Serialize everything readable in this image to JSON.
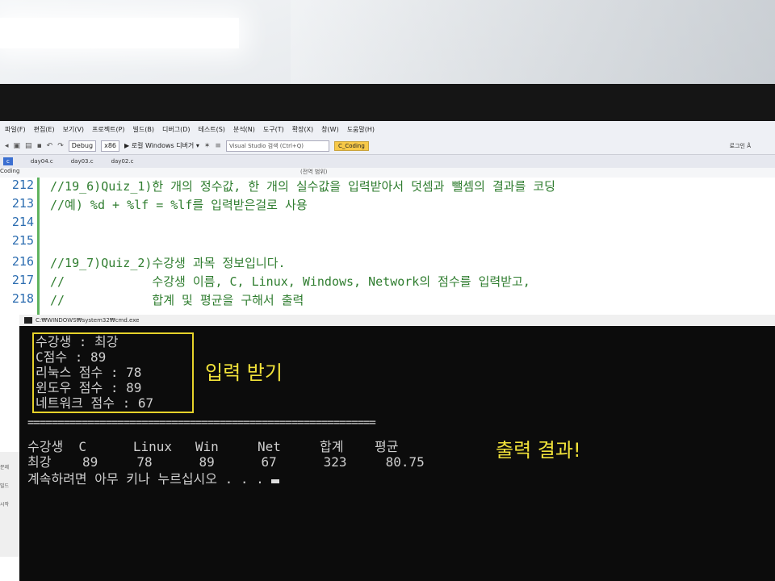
{
  "menu": [
    "파일(F)",
    "편집(E)",
    "보기(V)",
    "프로젝트(P)",
    "빌드(B)",
    "디버그(D)",
    "테스트(S)",
    "분석(N)",
    "도구(T)",
    "확장(X)",
    "창(W)",
    "도움말(H)"
  ],
  "toolbar": {
    "config": "Debug",
    "platform": "x86",
    "run_label": "▶ 로컬 Windows 디버거 ▾",
    "search_placeholder": "Visual Studio 검색 (Ctrl+Q)",
    "project": "C_Coding",
    "user": "로그인 Å"
  },
  "tabs": [
    "day04.c",
    "day03.c",
    "day02.c"
  ],
  "active_tab": "c",
  "nav": {
    "project_label": "Coding",
    "scope": "(전역 범위)"
  },
  "code_lines": [
    {
      "ln": "212",
      "text": "//19_6)Quiz_1)한 개의 정수값, 한 개의 실수값을 입력받아서 덧셈과 뺄셈의 결과를 코딩"
    },
    {
      "ln": "213",
      "text": "//예) %d + %lf = %lf를 입력받은걸로 사용"
    },
    {
      "ln": "214",
      "text": ""
    },
    {
      "ln": "215",
      "text": ""
    },
    {
      "ln": "216",
      "text": "//19_7)Quiz_2)수강생 과목 정보입니다."
    },
    {
      "ln": "217",
      "text": "//            수강생 이름, C, Linux, Windows, Network의 점수를 입력받고,"
    },
    {
      "ln": "218",
      "text": "//            합계 및 평균을 구해서 출력"
    }
  ],
  "console": {
    "title": "C:₩WINDOWS₩system32₩cmd.exe",
    "input_lines": [
      "수강생 : 최강",
      "C점수 : 89",
      "리눅스 점수 : 78",
      "윈도우 점수 : 89",
      "네트워크 점수 : 67"
    ],
    "divider": "==========================================================",
    "header": "수강생  C      Linux   Win     Net     합계    평균",
    "row": "최강    89     78      89      67      323     80.75",
    "prompt": "계속하려면 아무 키나 누르십시오 . . . ",
    "note_input": "입력 받기",
    "note_output": "출력 결과!"
  },
  "side_panel": [
    "문제",
    "빌드",
    "시작"
  ],
  "colors": {
    "accent_yellow": "#f1e23a",
    "comment_green": "#2f7d2f",
    "line_number_blue": "#2b6cb0"
  }
}
